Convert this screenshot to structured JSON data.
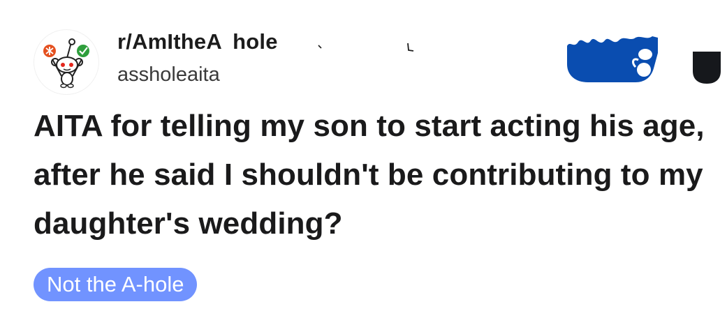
{
  "post_header": {
    "subreddit": "r/AmItheA  hole",
    "author": "assholeaita",
    "avatar_icon": "snoo-mascot-icon",
    "join_icon": "scribbled-join-button-icon",
    "overflow_icon": "more-options-icon"
  },
  "post": {
    "title": "AITA for telling my son to start acting his age, after he said I shouldn't be contributing to my daughter's wedding?",
    "flair": "Not the A-hole"
  },
  "colors": {
    "join_blue": "#0a4db0",
    "flair_bg": "#7193ff",
    "dark": "#1a1a1b"
  }
}
